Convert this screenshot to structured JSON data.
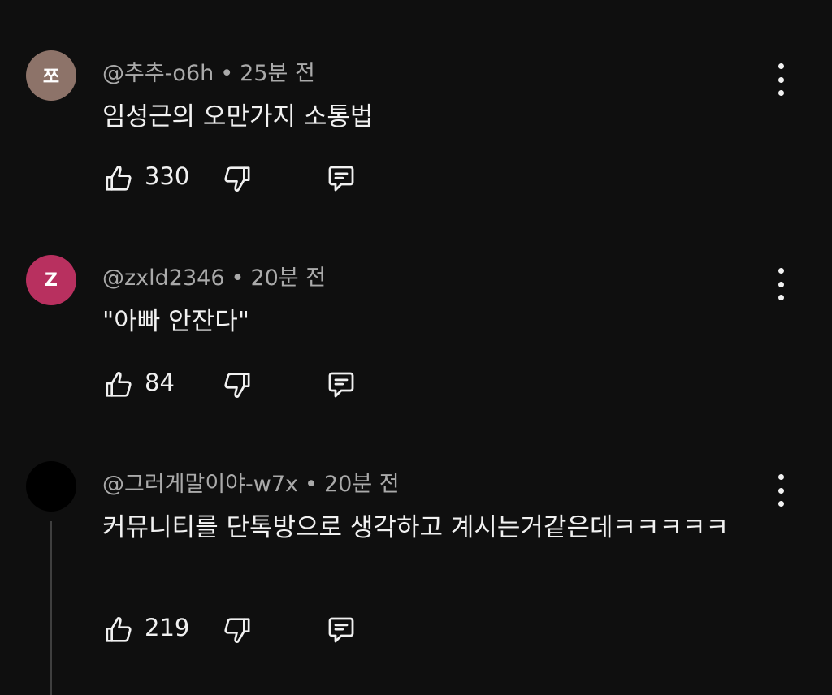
{
  "comments": [
    {
      "avatar_letter": "쪼",
      "avatar_color": "#8d7369",
      "author": "@추추-o6h",
      "time": "25분 전",
      "text": "임성근의 오만가지 소통법",
      "likes": "330"
    },
    {
      "avatar_letter": "Z",
      "avatar_color": "#b8305f",
      "author": "@zxld2346",
      "time": "20분 전",
      "text": "\"아빠 안잔다\"",
      "likes": "84"
    },
    {
      "avatar_letter": "",
      "avatar_color": "#000000",
      "author": "@그러게말이야-w7x",
      "time": "20분 전",
      "text": "커뮤니티를 단톡방으로 생각하고 계시는거같은데ㅋㅋㅋㅋㅋ",
      "likes": "219"
    }
  ],
  "icons": {
    "like": "thumbs-up-icon",
    "dislike": "thumbs-down-icon",
    "reply": "reply-icon",
    "more": "more-vert-icon"
  },
  "separator": "•"
}
